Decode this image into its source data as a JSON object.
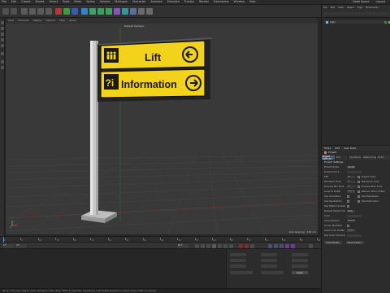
{
  "menubar": {
    "items": [
      "File",
      "Edit",
      "Create",
      "Modes",
      "Select",
      "Tools",
      "Mesh",
      "Spline",
      "Volume",
      "MoGraph",
      "Character",
      "Animate",
      "Simulate",
      "Tracker",
      "Render",
      "Extensions",
      "Window",
      "Help"
    ],
    "right_items": [
      "Node Space",
      "Layout"
    ]
  },
  "viewport": {
    "menu": [
      "View",
      "Cameras",
      "Display",
      "Options",
      "Filter",
      "Panel"
    ],
    "camera_label": "Default Camera",
    "grid_spacing": "Grid Spacing : 100 cm",
    "sign": {
      "panel_top_text": "Lift",
      "panel_bottom_text": "Information",
      "panel_bottom_icon_text": "?i",
      "panel_color": "#f2d21b",
      "frame_color": "#1a1a1a"
    }
  },
  "timeline": {
    "ticks": [
      "0",
      "5",
      "10",
      "15",
      "20",
      "25",
      "30",
      "35",
      "40",
      "45",
      "50",
      "55",
      "60",
      "65",
      "70",
      "75",
      "80",
      "85",
      "90"
    ],
    "current_frame": "0 F",
    "start_frame": "0 F",
    "end_frame": "90 F"
  },
  "coordinates": {
    "menu": [
      "Position",
      "Size",
      "Rotation"
    ],
    "apply_label": "Apply"
  },
  "statusbar": {
    "text": "Move: Click and drag to move elements. Hold down SHIFT to quantize movement / add to the selection in point mode, CTRL to remove."
  },
  "object_manager": {
    "menu": [
      "File",
      "Edit",
      "View",
      "Object",
      "Tags",
      "Bookmarks"
    ],
    "object_name": "Sign"
  },
  "attributes": {
    "menu": [
      "Mode",
      "Edit",
      "User Data"
    ],
    "object_label": "Project",
    "tabs": [
      "Project Settings",
      "Info",
      "Dynamics",
      "Referencing",
      "To Do"
    ],
    "section_title": "Project Settings",
    "rows": [
      {
        "label": "Project Scale",
        "value": "1 Centimeters"
      },
      {
        "label": "Scale Project...",
        "value": ""
      },
      {
        "label": "FPS",
        "value": "30"
      },
      {
        "label": "Minimum Time",
        "value": "0 F"
      },
      {
        "label": "Preview Min Time",
        "value": "0 F"
      },
      {
        "label": "Level of Detail",
        "value": "100 %"
      },
      {
        "label": "Use Animation",
        "value": "on"
      },
      {
        "label": "Use Generators",
        "value": "on"
      },
      {
        "label": "Use Motion System",
        "value": "on"
      },
      {
        "label": "Default Object Color",
        "value": "60% Gray"
      },
      {
        "label": "Color",
        "value": ""
      },
      {
        "label": "View Clipping",
        "value": "Medium"
      },
      {
        "label": "Linear Workflow",
        "value": "on"
      },
      {
        "label": "Input Color Profile",
        "value": "sRGB"
      },
      {
        "label": "Use Color Channel for Node Material",
        "value": ""
      }
    ],
    "right_labels": [
      "Project Time",
      "Maximum Time",
      "Preview Max Time",
      "Render LOD in Editor",
      "Use Expression",
      "Use Deformers"
    ],
    "buttons": [
      "Load Preset...",
      "Save Preset..."
    ]
  }
}
